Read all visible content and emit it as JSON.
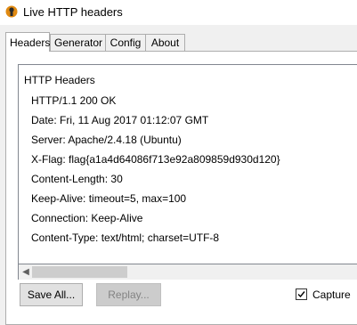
{
  "window": {
    "title": "Live HTTP headers",
    "icon": "live-http-headers-app-icon"
  },
  "tabs": [
    {
      "label": "Headers",
      "active": true
    },
    {
      "label": "Generator",
      "active": false
    },
    {
      "label": "Config",
      "active": false
    },
    {
      "label": "About",
      "active": false
    }
  ],
  "headers_panel": {
    "heading": "HTTP Headers",
    "lines": [
      "HTTP/1.1 200 OK",
      "Date: Fri, 11 Aug 2017 01:12:07 GMT",
      "Server: Apache/2.4.18 (Ubuntu)",
      "X-Flag: flag{a1a4d64086f713e92a809859d930d120}",
      "Content-Length: 30",
      "Keep-Alive: timeout=5, max=100",
      "Connection: Keep-Alive",
      "Content-Type: text/html; charset=UTF-8"
    ]
  },
  "buttons": {
    "save_all": "Save All...",
    "replay": "Replay..."
  },
  "capture": {
    "label": "Capture",
    "checked": true
  }
}
